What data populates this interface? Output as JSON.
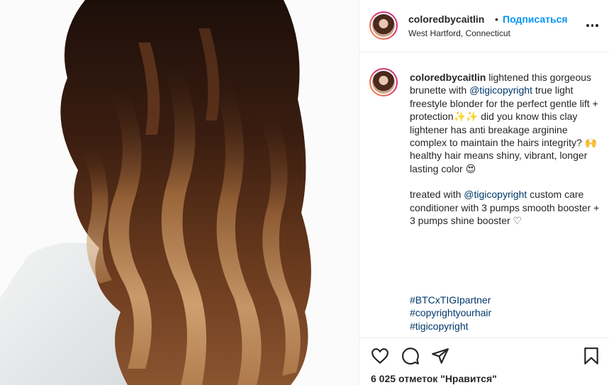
{
  "post": {
    "username": "coloredbycaitlin",
    "separator": "•",
    "follow_label": "Подписаться",
    "location": "West Hartford, Connecticut"
  },
  "caption": {
    "username": "coloredbycaitlin",
    "t1": "lightened this gorgeous brunette with",
    "mention1": "@tigicopyright",
    "t2": "true light freestyle blonder for the perfect gentle lift + protection",
    "emoji1": "✨✨",
    "t3": "did you know this clay lightener has anti breakage arginine complex to maintain the hairs integrity?",
    "emoji2": "🙌",
    "t4": "healthy hair means shiny, vibrant, longer lasting color",
    "emoji3": "😍",
    "t5": "treated with",
    "mention2": "@tigicopyright",
    "t6": "custom care conditioner with 3 pumps smooth booster + 3 pumps shine booster",
    "emoji4": "♡"
  },
  "hashtags": [
    "#BTCxTIGIpartner",
    "#copyrightyourhair",
    "#tigicopyright"
  ],
  "likes": {
    "count": "6 025",
    "label": "отметок \"Нравится\""
  },
  "icons": {
    "like": "heart-icon",
    "comment": "comment-icon",
    "share": "share-icon",
    "save": "bookmark-icon",
    "more": "more-icon"
  },
  "colors": {
    "follow": "#0095f6",
    "link": "#00376b",
    "text": "#262626",
    "border": "#efefef"
  }
}
